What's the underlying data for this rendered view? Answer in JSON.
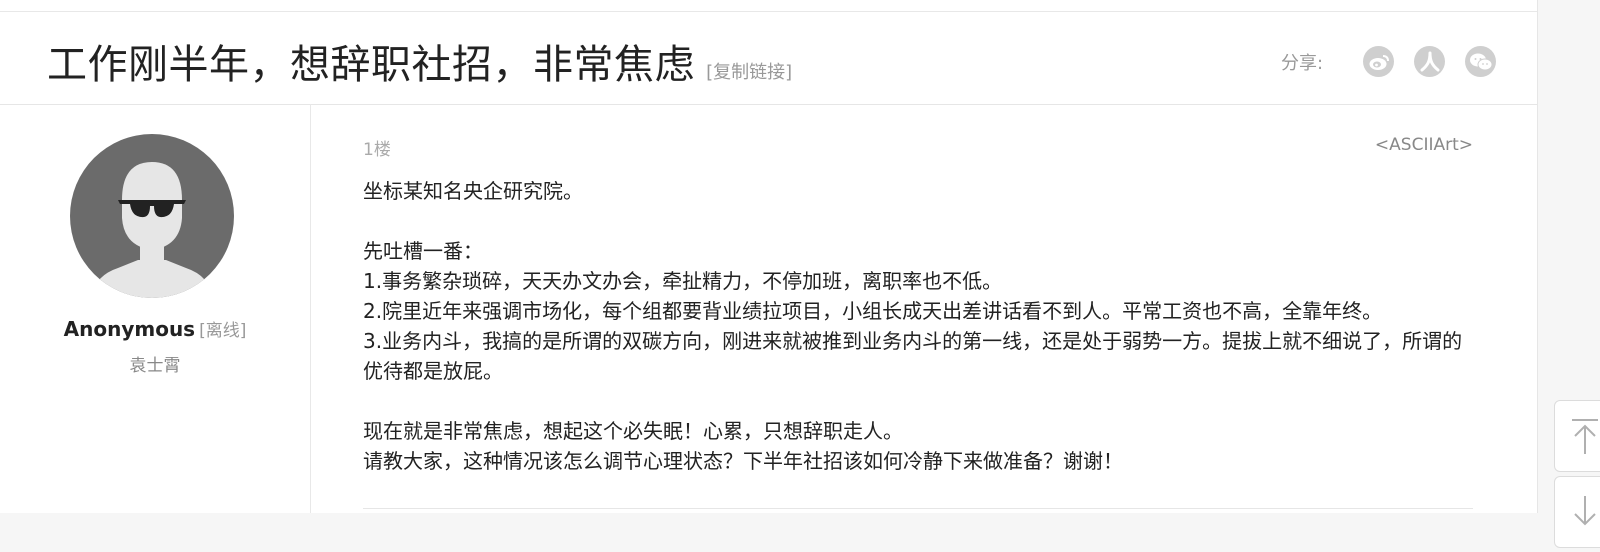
{
  "header": {
    "title": "工作刚半年，想辞职社招，非常焦虑",
    "copy_link_label": "[复制链接]",
    "share_label": "分享:",
    "share_buttons": [
      "weibo-icon",
      "renren-icon",
      "wechat-icon"
    ]
  },
  "author": {
    "name": "Anonymous",
    "status": "[离线]",
    "nickname": "袁士霄"
  },
  "post": {
    "floor": "1楼",
    "tag": "<ASCIIArt>",
    "lines": [
      "坐标某知名央企研究院。",
      "",
      "先吐槽一番：",
      "1.事务繁杂琐碎，天天办文办会，牵扯精力，不停加班，离职率也不低。",
      "2.院里近年来强调市场化，每个组都要背业绩拉项目，小组长成天出差讲话看不到人。平常工资也不高，全靠年终。",
      "3.业务内斗，我搞的是所谓的双碳方向，刚进来就被推到业务内斗的第一线，还是处于弱势一方。提拔上就不细说了，所谓的优待都是放屁。",
      "",
      "现在就是非常焦虑，想起这个必失眠！心累，只想辞职走人。",
      "请教大家，这种情况该怎么调节心理状态？下半年社招该如何冷静下来做准备？谢谢！"
    ]
  },
  "side_tools": [
    "back-to-top-icon",
    "scroll-down-icon"
  ],
  "colors": {
    "text": "#222222",
    "muted": "#999999",
    "avatar_bg": "#6b6b6b",
    "share_icon_bg": "#cfcfcf"
  }
}
